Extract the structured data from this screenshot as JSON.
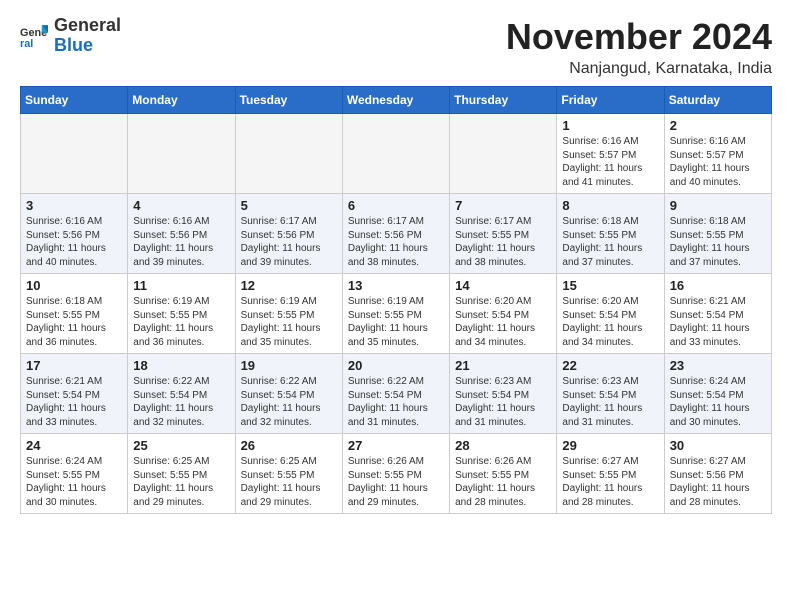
{
  "header": {
    "logo_general": "General",
    "logo_blue": "Blue",
    "month": "November 2024",
    "location": "Nanjangud, Karnataka, India"
  },
  "weekdays": [
    "Sunday",
    "Monday",
    "Tuesday",
    "Wednesday",
    "Thursday",
    "Friday",
    "Saturday"
  ],
  "weeks": [
    [
      {
        "day": "",
        "info": ""
      },
      {
        "day": "",
        "info": ""
      },
      {
        "day": "",
        "info": ""
      },
      {
        "day": "",
        "info": ""
      },
      {
        "day": "",
        "info": ""
      },
      {
        "day": "1",
        "info": "Sunrise: 6:16 AM\nSunset: 5:57 PM\nDaylight: 11 hours\nand 41 minutes."
      },
      {
        "day": "2",
        "info": "Sunrise: 6:16 AM\nSunset: 5:57 PM\nDaylight: 11 hours\nand 40 minutes."
      }
    ],
    [
      {
        "day": "3",
        "info": "Sunrise: 6:16 AM\nSunset: 5:56 PM\nDaylight: 11 hours\nand 40 minutes."
      },
      {
        "day": "4",
        "info": "Sunrise: 6:16 AM\nSunset: 5:56 PM\nDaylight: 11 hours\nand 39 minutes."
      },
      {
        "day": "5",
        "info": "Sunrise: 6:17 AM\nSunset: 5:56 PM\nDaylight: 11 hours\nand 39 minutes."
      },
      {
        "day": "6",
        "info": "Sunrise: 6:17 AM\nSunset: 5:56 PM\nDaylight: 11 hours\nand 38 minutes."
      },
      {
        "day": "7",
        "info": "Sunrise: 6:17 AM\nSunset: 5:55 PM\nDaylight: 11 hours\nand 38 minutes."
      },
      {
        "day": "8",
        "info": "Sunrise: 6:18 AM\nSunset: 5:55 PM\nDaylight: 11 hours\nand 37 minutes."
      },
      {
        "day": "9",
        "info": "Sunrise: 6:18 AM\nSunset: 5:55 PM\nDaylight: 11 hours\nand 37 minutes."
      }
    ],
    [
      {
        "day": "10",
        "info": "Sunrise: 6:18 AM\nSunset: 5:55 PM\nDaylight: 11 hours\nand 36 minutes."
      },
      {
        "day": "11",
        "info": "Sunrise: 6:19 AM\nSunset: 5:55 PM\nDaylight: 11 hours\nand 36 minutes."
      },
      {
        "day": "12",
        "info": "Sunrise: 6:19 AM\nSunset: 5:55 PM\nDaylight: 11 hours\nand 35 minutes."
      },
      {
        "day": "13",
        "info": "Sunrise: 6:19 AM\nSunset: 5:55 PM\nDaylight: 11 hours\nand 35 minutes."
      },
      {
        "day": "14",
        "info": "Sunrise: 6:20 AM\nSunset: 5:54 PM\nDaylight: 11 hours\nand 34 minutes."
      },
      {
        "day": "15",
        "info": "Sunrise: 6:20 AM\nSunset: 5:54 PM\nDaylight: 11 hours\nand 34 minutes."
      },
      {
        "day": "16",
        "info": "Sunrise: 6:21 AM\nSunset: 5:54 PM\nDaylight: 11 hours\nand 33 minutes."
      }
    ],
    [
      {
        "day": "17",
        "info": "Sunrise: 6:21 AM\nSunset: 5:54 PM\nDaylight: 11 hours\nand 33 minutes."
      },
      {
        "day": "18",
        "info": "Sunrise: 6:22 AM\nSunset: 5:54 PM\nDaylight: 11 hours\nand 32 minutes."
      },
      {
        "day": "19",
        "info": "Sunrise: 6:22 AM\nSunset: 5:54 PM\nDaylight: 11 hours\nand 32 minutes."
      },
      {
        "day": "20",
        "info": "Sunrise: 6:22 AM\nSunset: 5:54 PM\nDaylight: 11 hours\nand 31 minutes."
      },
      {
        "day": "21",
        "info": "Sunrise: 6:23 AM\nSunset: 5:54 PM\nDaylight: 11 hours\nand 31 minutes."
      },
      {
        "day": "22",
        "info": "Sunrise: 6:23 AM\nSunset: 5:54 PM\nDaylight: 11 hours\nand 31 minutes."
      },
      {
        "day": "23",
        "info": "Sunrise: 6:24 AM\nSunset: 5:54 PM\nDaylight: 11 hours\nand 30 minutes."
      }
    ],
    [
      {
        "day": "24",
        "info": "Sunrise: 6:24 AM\nSunset: 5:55 PM\nDaylight: 11 hours\nand 30 minutes."
      },
      {
        "day": "25",
        "info": "Sunrise: 6:25 AM\nSunset: 5:55 PM\nDaylight: 11 hours\nand 29 minutes."
      },
      {
        "day": "26",
        "info": "Sunrise: 6:25 AM\nSunset: 5:55 PM\nDaylight: 11 hours\nand 29 minutes."
      },
      {
        "day": "27",
        "info": "Sunrise: 6:26 AM\nSunset: 5:55 PM\nDaylight: 11 hours\nand 29 minutes."
      },
      {
        "day": "28",
        "info": "Sunrise: 6:26 AM\nSunset: 5:55 PM\nDaylight: 11 hours\nand 28 minutes."
      },
      {
        "day": "29",
        "info": "Sunrise: 6:27 AM\nSunset: 5:55 PM\nDaylight: 11 hours\nand 28 minutes."
      },
      {
        "day": "30",
        "info": "Sunrise: 6:27 AM\nSunset: 5:56 PM\nDaylight: 11 hours\nand 28 minutes."
      }
    ]
  ]
}
